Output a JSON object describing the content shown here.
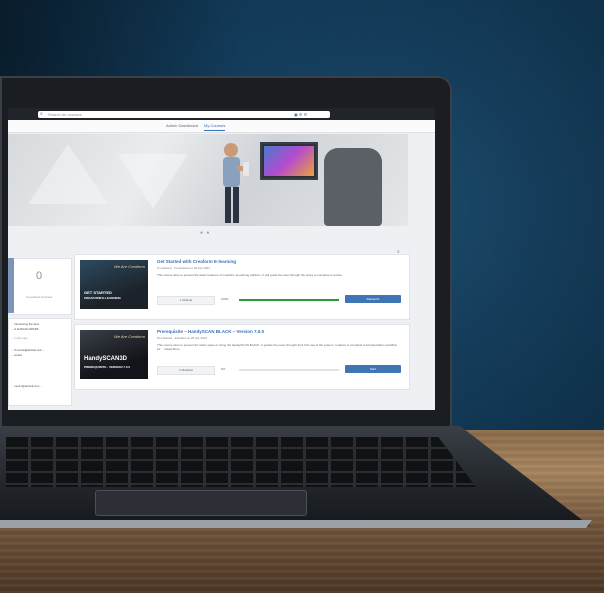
{
  "screen": {
    "search_placeholder": "Search for courses",
    "top_icons": "▣ ⚙ ☰",
    "subnav": {
      "admin": "Admin Dashboard",
      "courses": "My Courses"
    },
    "banner_dots": "● ●",
    "sidebar": {
      "stat_value": "0",
      "stat_label": "Completed Courses",
      "news": [
        "... Introducing the New",
        "... & SolSCAN SPARK",
        "... 2 days ago",
        "... rb.evans@artztek.com ...",
        "... ended",
        "... ment.r@artztek.com ..."
      ]
    },
    "courses": [
      {
        "title": "Get Started with Creaform E-learning",
        "status": "Completed",
        "date": "Completed on 26 Apr 2024",
        "desc": "This course aims to present the basic features of Creaform eLearning platform. It will guide the user through the steps to complete a course.",
        "modules": "1 Module",
        "percent": "100%",
        "progress": 1.0,
        "button": "Relaunch",
        "thumb_title": "GET STARTED",
        "thumb_sub": "CREAFORM E-LEARNING",
        "thumb_hand": "We Are Creaform"
      },
      {
        "title": "Prerequisite – HandySCAN BLACK – Version 7.0.0",
        "status": "Not Started",
        "date": "Enrolled on 26 Apr 2024",
        "desc": "This course aims to present the basic steps of using the HandySCAN BLACK. It guides the users through their first use of the system. It allows to complete a full acquisition workflow for ... Read More",
        "modules": "2 Modules",
        "percent": "0%",
        "progress": 0.0,
        "button": "Start",
        "thumb_title": "HandySCAN3D",
        "thumb_sub": "PREREQUISITE - VERSION 7.0.0",
        "thumb_hand": "We Are Creaform"
      }
    ]
  },
  "colors": {
    "wall": "#123a58",
    "accent": "#3f74b5",
    "progress": "#2e9b3a"
  }
}
